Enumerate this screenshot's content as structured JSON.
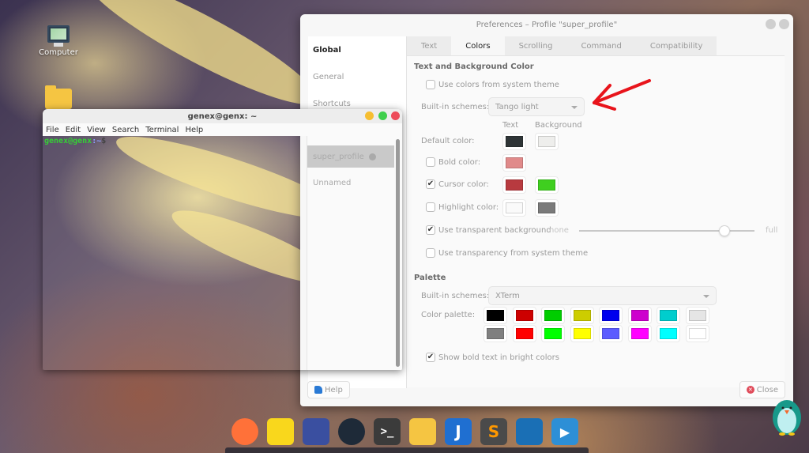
{
  "desktop": {
    "icons": [
      {
        "label": "Computer",
        "icon": "computer-icon"
      },
      {
        "label": "",
        "icon": "home-folder-icon"
      }
    ]
  },
  "preferences": {
    "title": "Preferences – Profile \"super_profile\"",
    "sidebar": {
      "items": [
        {
          "label": "Global",
          "bold": true
        },
        {
          "label": "General"
        },
        {
          "label": "Shortcuts"
        }
      ]
    },
    "tabs": [
      {
        "label": "Text",
        "active": false
      },
      {
        "label": "Colors",
        "active": true
      },
      {
        "label": "Scrolling",
        "active": false
      },
      {
        "label": "Command",
        "active": false
      },
      {
        "label": "Compatibility",
        "active": false
      }
    ],
    "text_bg_section": {
      "title": "Text and Background Color",
      "use_system_colors": {
        "label": "Use colors from system theme",
        "checked": false
      },
      "builtin_schemes": {
        "label": "Built-in schemes:",
        "value": "Tango light"
      },
      "col_text": "Text",
      "col_background": "Background",
      "default_color": {
        "label": "Default color:",
        "text": "#2e3436",
        "background": "#eeeeec"
      },
      "bold_color": {
        "label": "Bold color:",
        "checked": false,
        "text": "#e08a8a"
      },
      "cursor_color": {
        "label": "Cursor color:",
        "checked": true,
        "text": "#b83a3f",
        "background": "#3fcf1f"
      },
      "highlight_color": {
        "label": "Highlight color:",
        "checked": false,
        "text": "#fafafa",
        "background": "#7a7a7a"
      },
      "transparent_bg": {
        "label": "Use transparent background",
        "checked": true,
        "min_label": "none",
        "max_label": "full",
        "value": 0.83
      },
      "system_transparency": {
        "label": "Use transparency from system theme",
        "checked": false
      }
    },
    "palette_section": {
      "title": "Palette",
      "builtin_schemes": {
        "label": "Built-in schemes:",
        "value": "XTerm"
      },
      "color_palette_label": "Color palette:",
      "row1": [
        "#000000",
        "#cd0000",
        "#00cd00",
        "#cdcd00",
        "#0000ee",
        "#cd00cd",
        "#00cdcd",
        "#e5e5e5"
      ],
      "row2": [
        "#7f7f7f",
        "#ff0000",
        "#00ff00",
        "#ffff00",
        "#5c5cff",
        "#ff00ff",
        "#00ffff",
        "#ffffff"
      ],
      "bold_bright": {
        "label": "Show bold text in bright colors",
        "checked": true
      }
    },
    "help_label": "Help",
    "close_label": "Close"
  },
  "terminal": {
    "title": "genex@genx: ~",
    "menu": [
      "File",
      "Edit",
      "View",
      "Search",
      "Terminal",
      "Help"
    ],
    "prompt_user": "genex@genx",
    "prompt_path": ":~",
    "prompt_symbol": "$",
    "profile_list": [
      "super_profile",
      "Unnamed"
    ]
  },
  "dock": {
    "apps": [
      {
        "icon": "firefox-icon",
        "color": "#ff7139"
      },
      {
        "icon": "sticky-notes-icon",
        "color": "#f9d71c"
      },
      {
        "icon": "video-editor-icon",
        "color": "#3a4fa0"
      },
      {
        "icon": "speedometer-icon",
        "color": "#1e2a38"
      },
      {
        "icon": "terminal-icon",
        "color": "#3b3b3b"
      },
      {
        "icon": "files-icon",
        "color": "#f5c542"
      },
      {
        "icon": "joplin-icon",
        "color": "#1f6fd1"
      },
      {
        "icon": "sublime-text-icon",
        "color": "#4a4a4a"
      },
      {
        "icon": "cloud-add-icon",
        "color": "#1a6fb5"
      },
      {
        "icon": "media-player-icon",
        "color": "#2d8fd6"
      }
    ]
  },
  "annotation": {
    "arrow_color": "#e8141b"
  }
}
